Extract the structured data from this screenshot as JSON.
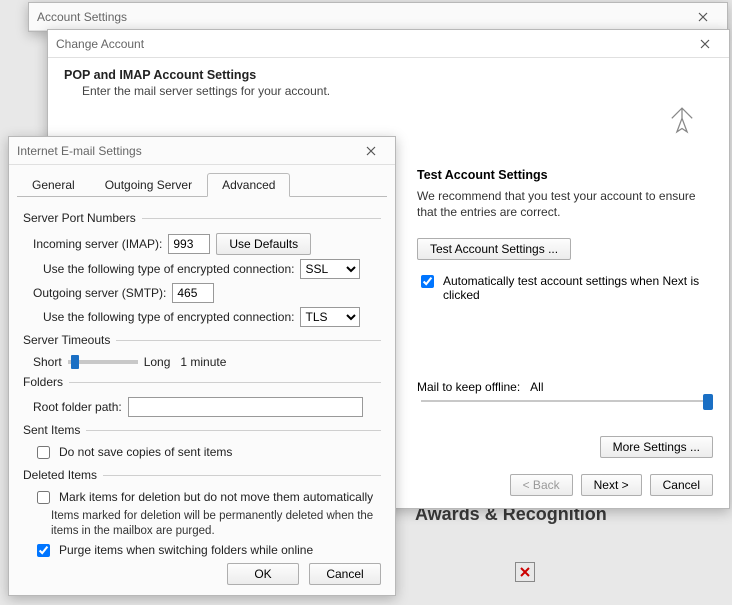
{
  "bg": {
    "section": "Awards & Recognition"
  },
  "win1": {
    "title": "Account Settings"
  },
  "win2": {
    "title": "Change Account",
    "heading": "POP and IMAP Account Settings",
    "sub": "Enter the mail server settings for your account.",
    "test_title": "Test Account Settings",
    "test_desc": "We recommend that you test your account to ensure that the entries are correct.",
    "test_btn": "Test Account Settings ...",
    "auto_test": "Automatically test account settings when Next is clicked",
    "auto_test_checked": true,
    "mail_label": "Mail to keep offline:",
    "mail_value": "All",
    "more": "More Settings ...",
    "back": "< Back",
    "next": "Next >",
    "cancel": "Cancel"
  },
  "win3": {
    "title": "Internet E-mail Settings",
    "tabs": {
      "general": "General",
      "outgoing": "Outgoing Server",
      "advanced": "Advanced"
    },
    "grp_ports": "Server Port Numbers",
    "incoming_label": "Incoming server (IMAP):",
    "incoming_value": "993",
    "use_defaults": "Use Defaults",
    "enc_label": "Use the following type of encrypted connection:",
    "incoming_enc": "SSL",
    "outgoing_label": "Outgoing server (SMTP):",
    "outgoing_value": "465",
    "outgoing_enc": "TLS",
    "grp_timeouts": "Server Timeouts",
    "short": "Short",
    "long": "Long",
    "timeout_val": "1 minute",
    "grp_folders": "Folders",
    "root_label": "Root folder path:",
    "root_value": "",
    "grp_sent": "Sent Items",
    "sent_chk": "Do not save copies of sent items",
    "sent_checked": false,
    "grp_deleted": "Deleted Items",
    "del_chk1": "Mark items for deletion but do not move them automatically",
    "del_chk1_checked": false,
    "del_note": "Items marked for deletion will be permanently deleted when the items in the mailbox are purged.",
    "del_chk2": "Purge items when switching folders while online",
    "del_chk2_checked": true,
    "ok": "OK",
    "cancel": "Cancel"
  }
}
